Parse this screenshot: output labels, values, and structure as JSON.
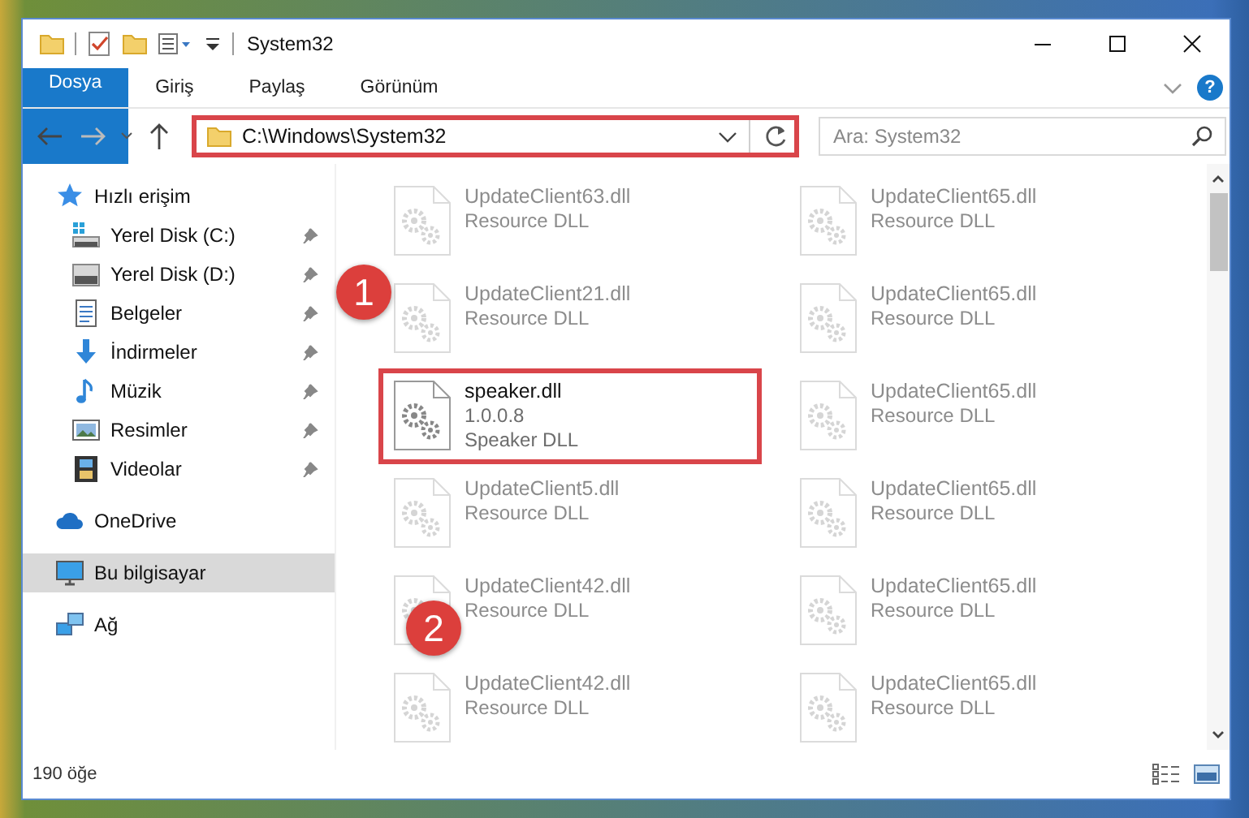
{
  "title_bar": {
    "title": "System32"
  },
  "ribbon": {
    "tabs": [
      {
        "label": "Dosya",
        "kind": "file"
      },
      {
        "label": "Giriş",
        "kind": "tab"
      },
      {
        "label": "Paylaş",
        "kind": "tab"
      },
      {
        "label": "Görünüm",
        "kind": "tab"
      }
    ],
    "help": "?"
  },
  "address_bar": {
    "path": "C:\\Windows\\System32",
    "highlighted": true
  },
  "search": {
    "placeholder": "Ara: System32"
  },
  "sidebar": {
    "items": [
      {
        "label": "Hızlı erişim",
        "kind": "star",
        "selected": false,
        "children": [
          {
            "label": "Yerel Disk (C:)",
            "kind": "system-drive",
            "pinned": true,
            "selected": false
          },
          {
            "label": "Yerel Disk (D:)",
            "kind": "drive",
            "pinned": true,
            "selected": false
          },
          {
            "label": "Belgeler",
            "kind": "documents",
            "pinned": true,
            "selected": false
          },
          {
            "label": "İndirmeler",
            "kind": "downloads",
            "pinned": true,
            "selected": false
          },
          {
            "label": "Müzik",
            "kind": "music",
            "pinned": true,
            "selected": false
          },
          {
            "label": "Resimler",
            "kind": "pictures",
            "pinned": true,
            "selected": false
          },
          {
            "label": "Videolar",
            "kind": "videos",
            "pinned": true,
            "selected": false
          }
        ]
      },
      {
        "label": "OneDrive",
        "kind": "cloud",
        "selected": false
      },
      {
        "label": "Bu bilgisayar",
        "kind": "computer",
        "selected": true
      },
      {
        "label": "Ağ",
        "kind": "network",
        "selected": false
      }
    ]
  },
  "files": [
    {
      "name": "UpdateClient63.dll",
      "details": [
        "Resource DLL"
      ],
      "faded": true,
      "highlighted": false
    },
    {
      "name": "UpdateClient65.dll",
      "details": [
        "Resource DLL"
      ],
      "faded": true,
      "highlighted": false
    },
    {
      "name": "UpdateClient21.dll",
      "details": [
        "Resource DLL"
      ],
      "faded": true,
      "highlighted": false
    },
    {
      "name": "UpdateClient65.dll",
      "details": [
        "Resource DLL"
      ],
      "faded": true,
      "highlighted": false
    },
    {
      "name": "speaker.dll",
      "details": [
        "1.0.0.8",
        "Speaker DLL"
      ],
      "faded": false,
      "highlighted": true
    },
    {
      "name": "UpdateClient65.dll",
      "details": [
        "Resource DLL"
      ],
      "faded": true,
      "highlighted": false
    },
    {
      "name": "UpdateClient5.dll",
      "details": [
        "Resource DLL"
      ],
      "faded": true,
      "highlighted": false
    },
    {
      "name": "UpdateClient65.dll",
      "details": [
        "Resource DLL"
      ],
      "faded": true,
      "highlighted": false
    },
    {
      "name": "UpdateClient42.dll",
      "details": [
        "Resource DLL"
      ],
      "faded": true,
      "highlighted": false
    },
    {
      "name": "UpdateClient65.dll",
      "details": [
        "Resource DLL"
      ],
      "faded": true,
      "highlighted": false
    },
    {
      "name": "UpdateClient42.dll",
      "details": [
        "Resource DLL"
      ],
      "faded": true,
      "highlighted": false
    },
    {
      "name": "UpdateClient65.dll",
      "details": [
        "Resource DLL"
      ],
      "faded": true,
      "highlighted": false
    }
  ],
  "callouts": [
    {
      "number": "1"
    },
    {
      "number": "2"
    }
  ],
  "status_bar": {
    "count": "190 öğe"
  }
}
